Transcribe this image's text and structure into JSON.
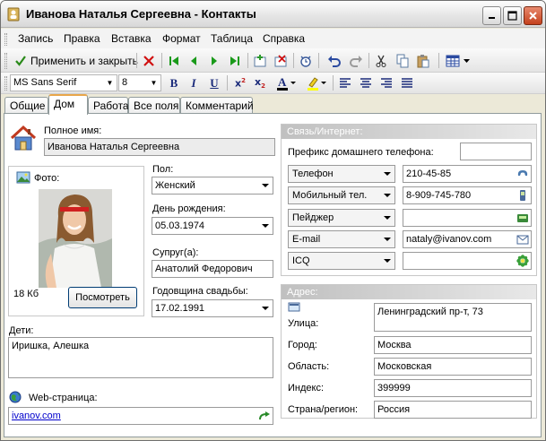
{
  "window": {
    "title": "Иванова Наталья Сергеевна - Контакты"
  },
  "menu": [
    "Запись",
    "Правка",
    "Вставка",
    "Формат",
    "Таблица",
    "Справка"
  ],
  "toolbar": {
    "apply_close": "Применить и закрыть"
  },
  "format": {
    "font": "MS Sans Serif",
    "size": "8"
  },
  "tabs": [
    "Общие",
    "Дом",
    "Работа",
    "Все поля",
    "Комментарий"
  ],
  "left": {
    "fullname_label": "Полное имя:",
    "fullname_value": "Иванова Наталья Сергеевна",
    "photo_label": "Фото:",
    "photo_size": "18 Кб",
    "view_button": "Посмотреть",
    "gender_label": "Пол:",
    "gender_value": "Женский",
    "birthday_label": "День рождения:",
    "birthday_value": "05.03.1974",
    "spouse_label": "Супруг(а):",
    "spouse_value": "Анатолий Федорович",
    "anniversary_label": "Годовщина свадьбы:",
    "anniversary_value": "17.02.1991",
    "children_label": "Дети:",
    "children_value": "Иришка, Алешка",
    "web_label": "Web-страница:",
    "web_value": "ivanov.com"
  },
  "contacts": {
    "header": "Связь/Интернет:",
    "prefix_label": "Префикс домашнего телефона:",
    "prefix_value": "",
    "rows": [
      {
        "label": "Телефон",
        "value": "210-45-85",
        "icon": "phone-icon"
      },
      {
        "label": "Мобильный тел.",
        "value": "8-909-745-780",
        "icon": "mobile-icon"
      },
      {
        "label": "Пейджер",
        "value": "",
        "icon": "pager-icon"
      },
      {
        "label": "E-mail",
        "value": "nataly@ivanov.com",
        "icon": "email-icon"
      },
      {
        "label": "ICQ",
        "value": "",
        "icon": "icq-icon"
      }
    ]
  },
  "address": {
    "header": "Адрес:",
    "street_label": "Улица:",
    "street_value": "Ленинградский пр-т, 73",
    "city_label": "Город:",
    "city_value": "Москва",
    "region_label": "Область:",
    "region_value": "Московская",
    "zip_label": "Индекс:",
    "zip_value": "399999",
    "country_label": "Страна/регион:",
    "country_value": "Россия"
  }
}
